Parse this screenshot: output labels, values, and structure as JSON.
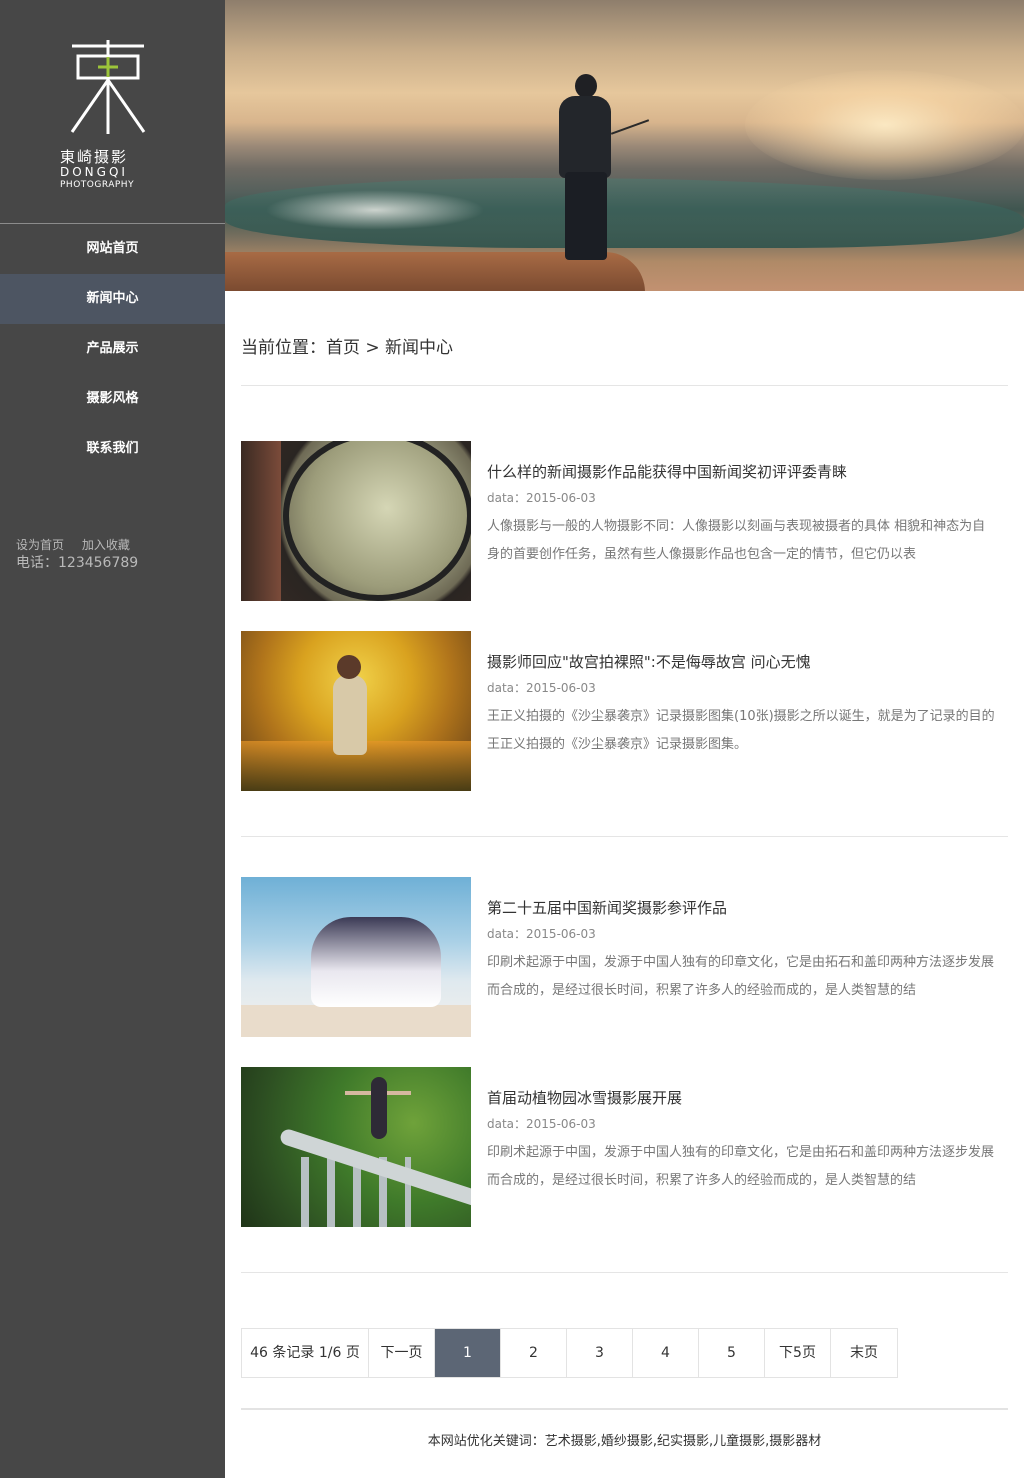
{
  "logo": {
    "chinese_name": "東崎摄影",
    "english_name": "DONGQI",
    "english_sub": "PHOTOGRAPHY"
  },
  "nav": {
    "items": [
      {
        "label": "网站首页"
      },
      {
        "label": "新闻中心",
        "active": true
      },
      {
        "label": "产品展示"
      },
      {
        "label": "摄影风格"
      },
      {
        "label": "联系我们"
      }
    ]
  },
  "sidebar": {
    "set_home": "设为首页",
    "add_favorite": "加入收藏",
    "phone": "电话：123456789"
  },
  "breadcrumb": {
    "text": "当前位置：首页 > 新闻中心"
  },
  "news": [
    {
      "title": "什么样的新闻摄影作品能获得中国新闻奖初评评委青睐",
      "date": "data：2015-06-03",
      "desc": "人像摄影与一般的人物摄影不同：人像摄影以刻画与表现被摄者的具体 相貌和神态为自身的首要创作任务，虽然有些人像摄影作品也包含一定的情节，但它仍以表"
    },
    {
      "title": "摄影师回应\"故宫拍裸照\":不是侮辱故宫 问心无愧",
      "date": "data：2015-06-03",
      "desc": "王正义拍摄的《沙尘暴袭京》记录摄影图集(10张)摄影之所以诞生，就是为了记录的目的王正义拍摄的《沙尘暴袭京》记录摄影图集。"
    },
    {
      "title": "第二十五届中国新闻奖摄影参评作品",
      "date": "data：2015-06-03",
      "desc": "印刷术起源于中国，发源于中国人独有的印章文化，它是由拓石和盖印两种方法逐步发展而合成的，是经过很长时间，积累了许多人的经验而成的，是人类智慧的结"
    },
    {
      "title": "首届动植物园冰雪摄影展开展",
      "date": "data：2015-06-03",
      "desc": "印刷术起源于中国，发源于中国人独有的印章文化，它是由拓石和盖印两种方法逐步发展而合成的，是经过很长时间，积累了许多人的经验而成的，是人类智慧的结"
    }
  ],
  "pager": {
    "info": "46 条记录 1/6 页",
    "next": "下一页",
    "pages": [
      "1",
      "2",
      "3",
      "4",
      "5"
    ],
    "current": "1",
    "next5": "下5页",
    "last": "末页"
  },
  "footer": {
    "keywords": "本网站优化关键词：艺术摄影,婚纱摄影,纪实摄影,儿童摄影,摄影器材"
  },
  "colors": {
    "sidebar_bg": "#474747",
    "nav_active_bg": "#4d5562",
    "pager_active_bg": "#5c6675",
    "logo_accent": "#9cc43a"
  },
  "icons": [
    "dongqi-logo-icon"
  ]
}
